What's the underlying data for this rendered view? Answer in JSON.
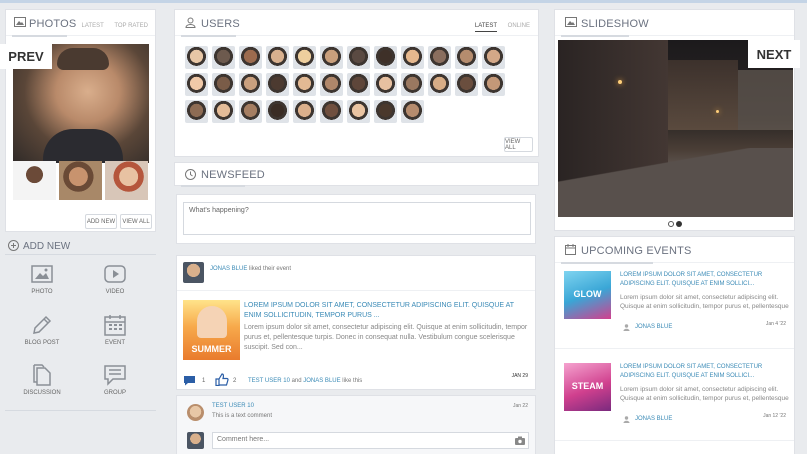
{
  "photos": {
    "title": "Photos",
    "tabs": [
      "Latest",
      "Top Rated"
    ],
    "prev_label": "PREV",
    "add_new": "Add New",
    "view_all": "View All"
  },
  "add_new": {
    "title": "Add New",
    "items": [
      {
        "label": "Photo",
        "icon": "photo-icon"
      },
      {
        "label": "Video",
        "icon": "video-icon"
      },
      {
        "label": "Blog Post",
        "icon": "pencil-icon"
      },
      {
        "label": "Event",
        "icon": "calendar-icon"
      },
      {
        "label": "Discussion",
        "icon": "documents-icon"
      },
      {
        "label": "Group",
        "icon": "chat-icon"
      }
    ]
  },
  "users": {
    "title": "Users",
    "tabs": [
      "Latest",
      "Online"
    ],
    "view_all": "View All",
    "avatar_colors": [
      "#e8c7a6",
      "#6d5a4e",
      "#9c6b4e",
      "#d9b18f",
      "#eecf9e",
      "#c99f7c",
      "#5a4a42",
      "#3e3028",
      "#e6b88e",
      "#8a6e5e",
      "#b58c6e",
      "#d4a888",
      "#f0c9a8",
      "#7a5c48",
      "#caa07e",
      "#4c3a30",
      "#e2b994",
      "#b0876a",
      "#5e463a",
      "#e7c0a0",
      "#9a7860",
      "#d8ad86",
      "#6a4e3e",
      "#c49878",
      "#8e6c54",
      "#e4bc98",
      "#a57e62",
      "#3a2c24",
      "#dcb08c",
      "#704f3e",
      "#eac4a2",
      "#4a382c",
      "#b68c6e"
    ]
  },
  "newsfeed": {
    "title": "Newsfeed",
    "composer_placeholder": "What's happening?",
    "post": {
      "author": "Jonas Blue",
      "action": "liked their event",
      "event_title": "Lorem ipsum dolor sit amet, consectetur adipiscing elit. Quisque at enim sollicitudin, tempor purus ...",
      "event_body": "Lorem ipsum dolor sit amet, consectetur adipiscing elit. Quisque at enim sollicitudin, tempor purus et, pellentesque turpis. Donec in consequat nulla. Vestibulum congue scelerisque suscipit. Sed con...",
      "image_caption": "SUMMER",
      "comment_count": "1",
      "like_count": "2",
      "likers_a": "Test User 10",
      "likers_and": "and",
      "likers_b": "Jonas Blue",
      "likers_suffix": "like this",
      "date": "Jan 29"
    },
    "comment": {
      "author": "Test User 10",
      "text": "This is a text comment",
      "date": "Jan 22"
    },
    "comment_placeholder": "Comment here..."
  },
  "slideshow": {
    "title": "Slideshow",
    "next_label": "NEXT",
    "active_dot": 1
  },
  "events": {
    "title": "Upcoming Events",
    "items": [
      {
        "title": "Lorem ipsum dolor sit amet, consectetur adipiscing elit. Quisque at enim sollici...",
        "body": "Lorem ipsum dolor sit amet, consectetur adipiscing elit. Quisque at enim sollicitudin, tempor purus et, pellentesque",
        "author": "Jonas Blue",
        "date": "Jan 4 '22",
        "image_caption": "GLOW",
        "color": "#3aa6d6"
      },
      {
        "title": "Lorem ipsum dolor sit amet, consectetur adipiscing elit. Quisque at enim sollici...",
        "body": "Lorem ipsum dolor sit amet, consectetur adipiscing elit. Quisque at enim sollicitudin, tempor purus et, pellentesque",
        "author": "Jonas Blue",
        "date": "Jan 12 '22",
        "image_caption": "STEAM",
        "color": "#d0408e"
      }
    ]
  }
}
